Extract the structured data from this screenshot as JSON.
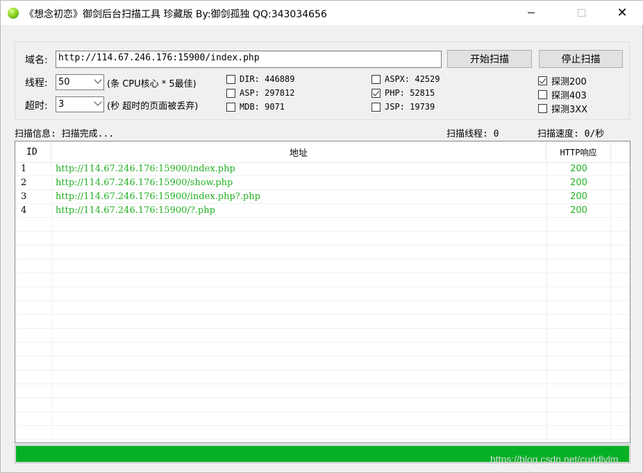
{
  "window": {
    "title": "《想念初恋》御剑后台扫描工具 珍藏版 By:御剑孤独 QQ:343034656",
    "close_glyph": "✕"
  },
  "form": {
    "domain_label": "域名:",
    "domain_value": "http://114.67.246.176:15900/index.php",
    "start_button": "开始扫描",
    "stop_button": "停止扫描",
    "threads_label": "线程:",
    "threads_value": "50",
    "threads_hint": "(条 CPU核心 * 5最佳)",
    "timeout_label": "超时:",
    "timeout_value": "3",
    "timeout_hint": "(秒 超时的页面被丢弃)"
  },
  "dictionaries": [
    {
      "label": "DIR: 446889",
      "checked": false
    },
    {
      "label": "ASP: 297812",
      "checked": false
    },
    {
      "label": "MDB: 9071",
      "checked": false
    },
    {
      "label": "ASPX: 42529",
      "checked": false
    },
    {
      "label": "PHP: 52815",
      "checked": true
    },
    {
      "label": "JSP: 19739",
      "checked": false
    }
  ],
  "probes": [
    {
      "label": "探测200",
      "checked": true
    },
    {
      "label": "探测403",
      "checked": false
    },
    {
      "label": "探测3XX",
      "checked": false
    }
  ],
  "status": {
    "info": "扫描信息: 扫描完成...",
    "threads": "扫描线程: 0",
    "speed": "扫描速度: 0/秒"
  },
  "table": {
    "headers": {
      "id": "ID",
      "address": "地址",
      "http": "HTTP响应"
    },
    "rows": [
      {
        "id": "1",
        "url": "http://114.67.246.176:15900/index.php",
        "code": "200"
      },
      {
        "id": "2",
        "url": "http://114.67.246.176:15900/show.php",
        "code": "200"
      },
      {
        "id": "3",
        "url": "http://114.67.246.176:15900/index.php?.php",
        "code": "200"
      },
      {
        "id": "4",
        "url": "http://114.67.246.176:15900/?.php",
        "code": "200"
      }
    ]
  },
  "progress": {
    "value": 1.0,
    "color": "#06b025"
  },
  "watermark": "https://blog.csdn.net/cuddlylm",
  "colors": {
    "result_text": "#22b022"
  }
}
